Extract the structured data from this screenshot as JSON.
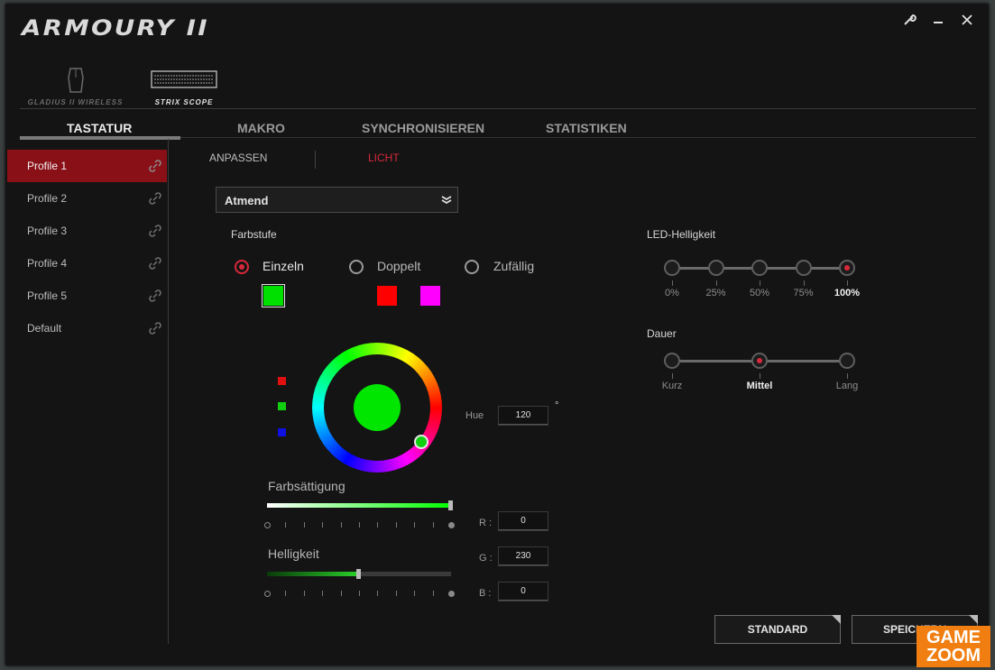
{
  "window": {
    "title": "ARMOURY II"
  },
  "devices": [
    {
      "label": "GLADIUS II WIRELESS",
      "active": false
    },
    {
      "label": "STRIX SCOPE",
      "active": true
    }
  ],
  "tabs": [
    {
      "label": "TASTATUR"
    },
    {
      "label": "MAKRO"
    },
    {
      "label": "SYNCHRONISIEREN"
    },
    {
      "label": "STATISTIKEN"
    }
  ],
  "profiles": [
    {
      "label": "Profile 1"
    },
    {
      "label": "Profile 2"
    },
    {
      "label": "Profile 3"
    },
    {
      "label": "Profile 4"
    },
    {
      "label": "Profile 5"
    },
    {
      "label": "Default"
    }
  ],
  "subtabs": {
    "customize": "ANPASSEN",
    "light": "LICHT"
  },
  "effect": {
    "selected": "Atmend"
  },
  "color_level": {
    "title": "Farbstufe",
    "options": [
      "Einzeln",
      "Doppelt",
      "Zufällig"
    ],
    "selected": "Einzeln"
  },
  "swatches": {
    "single": "#00e000",
    "double_a": "#ff0000",
    "double_b": "#ff00ff"
  },
  "picker": {
    "hue_label": "Hue",
    "hue_value": "120",
    "degree": "°",
    "current_color": "#00e600",
    "saturation_label": "Farbsättigung",
    "saturation_level": 1.0,
    "brightness_label": "Helligkeit",
    "brightness_level": 0.5,
    "r_label": "R :",
    "r_value": "0",
    "g_label": "G :",
    "g_value": "230",
    "b_label": "B :",
    "b_value": "0"
  },
  "led_brightness": {
    "title": "LED-Helligkeit",
    "steps": [
      "0%",
      "25%",
      "50%",
      "75%",
      "100%"
    ],
    "selected": "100%"
  },
  "duration": {
    "title": "Dauer",
    "steps": [
      "Kurz",
      "Mittel",
      "Lang"
    ],
    "selected": "Mittel"
  },
  "buttons": {
    "default": "STANDARD",
    "save": "SPEICHERN"
  },
  "watermark": {
    "line1": "GAME",
    "line2": "ZOOM"
  },
  "colors": {
    "accent": "#d8283a",
    "active_profile": "#8a1018"
  }
}
